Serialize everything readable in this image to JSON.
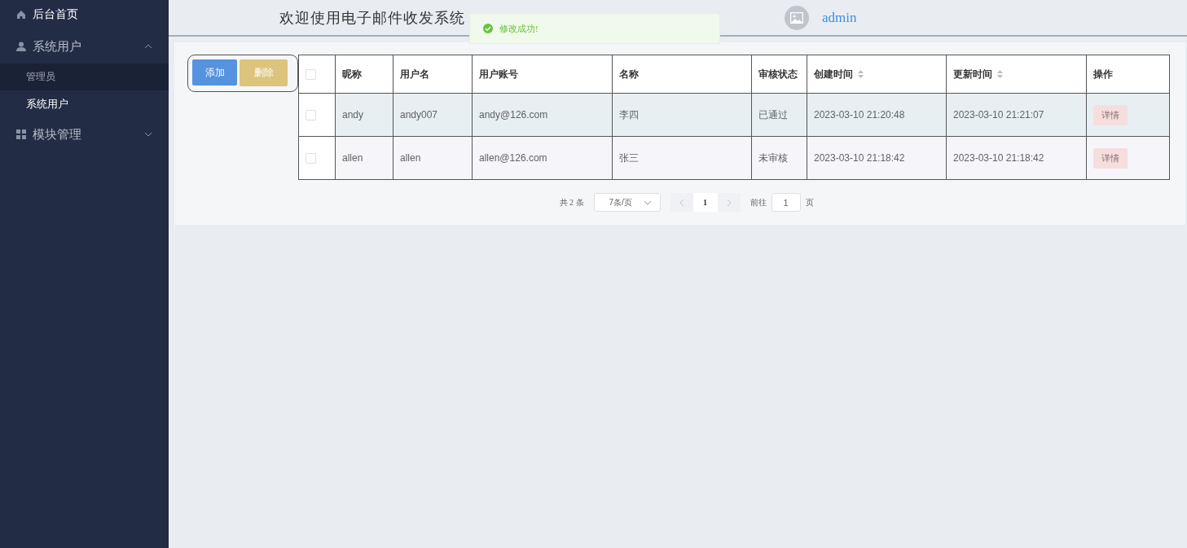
{
  "sidebar": {
    "items": [
      {
        "label": "后台首页",
        "kind": "home"
      },
      {
        "label": "系统用户",
        "kind": "user",
        "expanded": true,
        "children": [
          {
            "label": "管理员",
            "selected": false,
            "hovered": true
          },
          {
            "label": "系统用户",
            "selected": true,
            "hovered": false
          }
        ]
      },
      {
        "label": "模块管理",
        "kind": "grid",
        "expanded": false
      }
    ]
  },
  "header": {
    "title": "欢迎使用电子邮件收发系统",
    "user": "admin"
  },
  "toast": {
    "kind": "success",
    "message": "修改成功!"
  },
  "toolbar": {
    "buttons": [
      {
        "label": "添加",
        "kind": "primary"
      },
      {
        "label": "删除",
        "kind": "warning"
      }
    ]
  },
  "table": {
    "select_all": {
      "checked": false
    },
    "columns": [
      {
        "label": "昵称",
        "sortable": false
      },
      {
        "label": "用户名",
        "sortable": false
      },
      {
        "label": "用户账号",
        "sortable": false
      },
      {
        "label": "名称",
        "sortable": false
      },
      {
        "label": "审核状态",
        "sortable": false
      },
      {
        "label": "创建时间",
        "sortable": true
      },
      {
        "label": "更新时间",
        "sortable": true
      },
      {
        "label": "操作",
        "sortable": false
      }
    ],
    "rows": [
      {
        "checked": false,
        "hovered": true,
        "cells": [
          "andy",
          "andy007",
          "andy@126.com",
          "李四",
          "已通过",
          "2023-03-10 21:20:48",
          "2023-03-10 21:21:07"
        ],
        "action": "详情"
      },
      {
        "checked": false,
        "hovered": false,
        "cells": [
          "allen",
          "allen",
          "allen@126.com",
          "张三",
          "未审核",
          "2023-03-10 21:18:42",
          "2023-03-10 21:18:42"
        ],
        "action": "详情"
      }
    ]
  },
  "pagination": {
    "total": "共 2 条",
    "page_size": "7条/页",
    "current_page": "1",
    "goto_label": "前往",
    "goto_value": "1",
    "goto_suffix": "页"
  }
}
